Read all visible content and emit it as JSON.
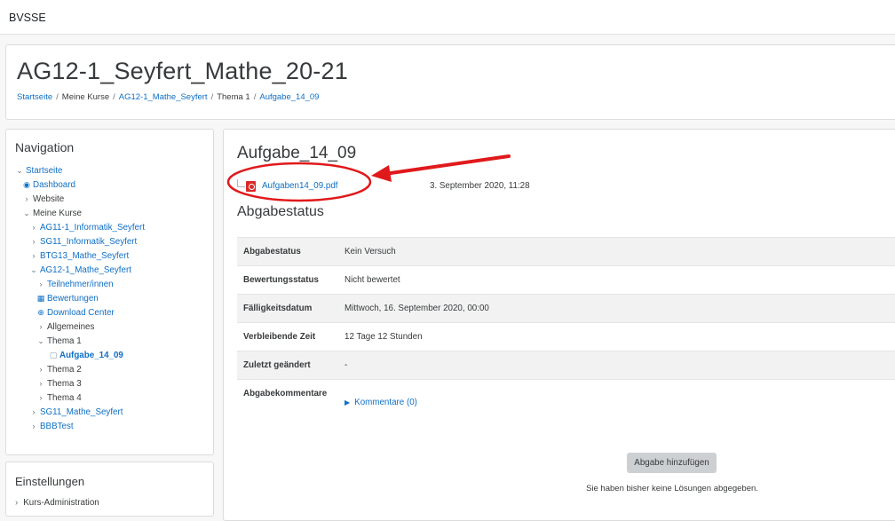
{
  "topbar": {
    "site_name": "BVSSE"
  },
  "header": {
    "course_title": "AG12-1_Seyfert_Mathe_20-21",
    "breadcrumb": [
      "Startseite",
      "Meine Kurse",
      "AG12-1_Mathe_Seyfert",
      "Thema 1",
      "Aufgabe_14_09"
    ]
  },
  "navigation": {
    "title": "Navigation",
    "items": [
      {
        "label": "Startseite",
        "icon": "chevron-down-icon"
      },
      {
        "label": "Dashboard",
        "icon": "dashboard-icon"
      },
      {
        "label": "Website",
        "icon": "chevron-right-icon"
      },
      {
        "label": "Meine Kurse",
        "icon": "chevron-down-icon"
      },
      {
        "label": "AG11-1_Informatik_Seyfert",
        "icon": "chevron-right-icon"
      },
      {
        "label": "SG11_Informatik_Seyfert",
        "icon": "chevron-right-icon"
      },
      {
        "label": "BTG13_Mathe_Seyfert",
        "icon": "chevron-right-icon"
      },
      {
        "label": "AG12-1_Mathe_Seyfert",
        "icon": "chevron-down-icon"
      },
      {
        "label": "Teilnehmer/innen",
        "icon": "chevron-right-icon"
      },
      {
        "label": "Bewertungen",
        "icon": "table-icon"
      },
      {
        "label": "Download Center",
        "icon": "download-icon"
      },
      {
        "label": "Allgemeines",
        "icon": "chevron-right-icon"
      },
      {
        "label": "Thema 1",
        "icon": "chevron-down-icon"
      },
      {
        "label": "Aufgabe_14_09",
        "icon": "assignment-icon"
      },
      {
        "label": "Thema 2",
        "icon": "chevron-right-icon"
      },
      {
        "label": "Thema 3",
        "icon": "chevron-right-icon"
      },
      {
        "label": "Thema 4",
        "icon": "chevron-right-icon"
      },
      {
        "label": "SG11_Mathe_Seyfert",
        "icon": "chevron-right-icon"
      },
      {
        "label": "BBBTest",
        "icon": "chevron-right-icon"
      }
    ]
  },
  "settings": {
    "title": "Einstellungen",
    "first_item": "Kurs-Administration"
  },
  "assignment": {
    "title": "Aufgabe_14_09",
    "file_name": "Aufgaben14_09.pdf",
    "file_date": "3. September 2020, 11:28",
    "status_heading": "Abgabestatus",
    "status_rows": [
      {
        "label": "Abgabestatus",
        "value": "Kein Versuch"
      },
      {
        "label": "Bewertungsstatus",
        "value": "Nicht bewertet"
      },
      {
        "label": "Fälligkeitsdatum",
        "value": "Mittwoch, 16. September 2020, 00:00"
      },
      {
        "label": "Verbleibende Zeit",
        "value": "12 Tage 12 Stunden"
      },
      {
        "label": "Zuletzt geändert",
        "value": "-"
      },
      {
        "label": "Abgabekommentare",
        "value": "Kommentare (0)"
      }
    ],
    "add_button": "Abgabe hinzufügen",
    "no_submission_text": "Sie haben bisher keine Lösungen abgegeben."
  },
  "colors": {
    "link": "#0f6fc5",
    "annotation_red": "#e0191b",
    "pdf_red": "#d92a2a"
  }
}
